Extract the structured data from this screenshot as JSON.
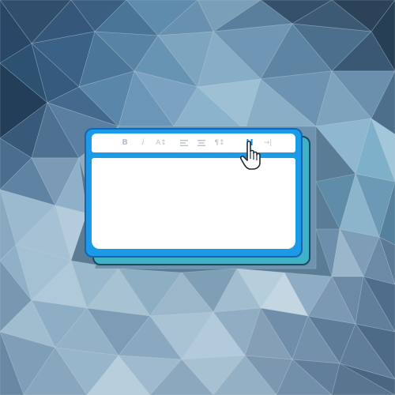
{
  "toolbar": {
    "tools": [
      {
        "name": "bold",
        "glyph": "B"
      },
      {
        "name": "italic",
        "glyph": "i"
      },
      {
        "name": "font-size",
        "glyph": "A↕"
      },
      {
        "name": "align-left",
        "glyph": ""
      },
      {
        "name": "align-center",
        "glyph": ""
      },
      {
        "name": "paragraph",
        "glyph": "¶↕"
      },
      {
        "name": "heading",
        "glyph": "H"
      },
      {
        "name": "insert-divider",
        "glyph": "→|"
      }
    ],
    "active_tool": "heading"
  },
  "colors": {
    "editor_frame": "#1b9ae7",
    "editor_frame_border": "#1565b0",
    "editor_shadow": "#3fb2c6",
    "toolbar_icon": "#b9c2cc",
    "toolbar_icon_active": "#1b8ee0",
    "canvas": "#ffffff"
  },
  "icons": {
    "cursor": "hand-pointer-icon"
  }
}
